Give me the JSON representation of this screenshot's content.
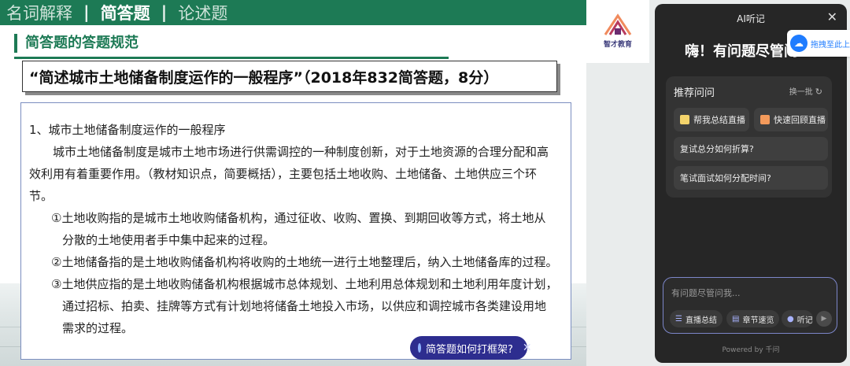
{
  "slide": {
    "nav": {
      "item1": "名词解释",
      "item2": "简答题",
      "item3": "论述题",
      "separator": "|"
    },
    "section_title": "简答题的答题规范",
    "question": "“简述城市土地储备制度运作的一般程序”（2018年832简答题，8分）",
    "content": {
      "heading": "1、城市土地储备制度运作的一般程序",
      "para1_line1": "城市土地储备制度是城市土地市场进行供需调控的一种制度创新，对于土地资源的合理分配和高",
      "para1_line2": "效利用有着重要作用。（教材知识点，简要概括），主要包括土地收购、土地储备、土地供应三个环",
      "para1_line3": "节。",
      "item1_line1": "①土地收购指的是城市土地收购储备机构，通过征收、收购、置换、到期回收等方式，将土地从",
      "item1_line2": "分散的土地使用者手中集中起来的过程。",
      "item2_line1": "②土地储备指的是土地收购储备机构将收购的土地统一进行土地整理后，纳入土地储备库的过程。",
      "item3_line1": "③土地供应指的是土地收购储备机构根据城市总体规划、土地利用总体规划和土地利用年度计划，",
      "item3_line2": "通过招标、拍卖、挂牌等方式有计划地将储备土地投入市场，以供应和调控城市各类建设用地",
      "item3_line3": "需求的过程。"
    },
    "floating_chip": {
      "label": "简答题如何打框架?",
      "close": "✕"
    }
  },
  "logo": {
    "text": "智才教育"
  },
  "panel": {
    "title": "AI听记",
    "close": "✕",
    "greeting": "嗨！有问题尽管问",
    "recommend": {
      "heading": "推荐问问",
      "refresh_label": "换一批",
      "refresh_icon": "↻",
      "chips": [
        "帮我总结直播",
        "快速回顾直播",
        "复试总分如何折算?",
        "笔试面试如何分配时间?"
      ]
    },
    "drag_tip": "拖拽至此上",
    "input": {
      "placeholder": "有问题尽管问我...",
      "quick": [
        "直播总结",
        "章节速览",
        "听记"
      ]
    },
    "powered_by": "Powered by 千问"
  },
  "colors": {
    "slide_green": "#1d7a55",
    "panel_bg": "#262626",
    "chip_blue": "#2d2d8f",
    "accent_blue": "#1f7cff"
  },
  "icons": [
    "close-icon",
    "refresh-icon",
    "note-icon",
    "rocket-icon",
    "cloud-icon",
    "list-icon",
    "book-icon",
    "mic-icon",
    "send-icon",
    "spark-icon"
  ]
}
